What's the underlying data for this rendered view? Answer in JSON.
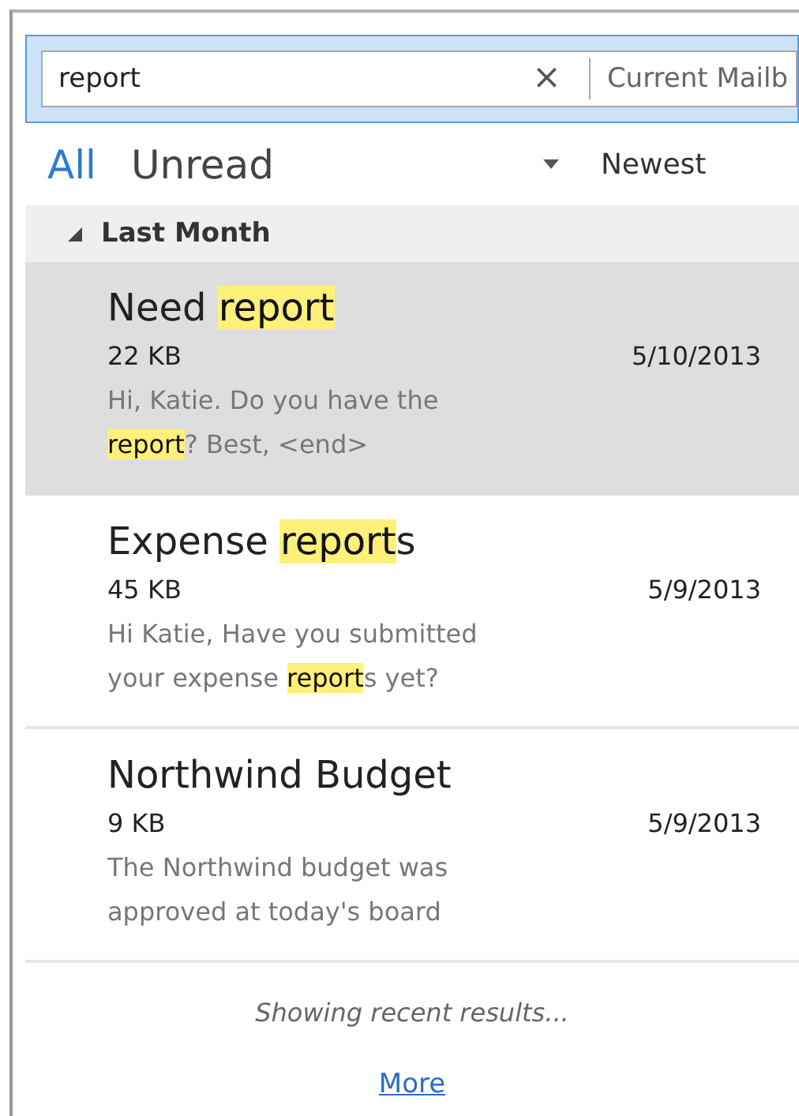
{
  "search": {
    "value": "report",
    "clear": "×",
    "scope": "Current Mailb"
  },
  "filters": [
    {
      "label": "All",
      "selected": true
    },
    {
      "label": "Unread",
      "selected": false
    }
  ],
  "sort": {
    "label": "Newest"
  },
  "group": {
    "title": "Last Month",
    "expanded": true
  },
  "messages": [
    {
      "selected": true,
      "subject": [
        {
          "text": "Need ",
          "highlight": false
        },
        {
          "text": "report",
          "highlight": true
        }
      ],
      "size": "22 KB",
      "date": "5/10/2013",
      "preview": [
        [
          {
            "text": "Hi, Katie. Do you have the",
            "highlight": false
          }
        ],
        [
          {
            "text": "report",
            "highlight": true
          },
          {
            "text": "?  Best, <end>",
            "highlight": false
          }
        ]
      ]
    },
    {
      "selected": false,
      "subject": [
        {
          "text": "Expense ",
          "highlight": false
        },
        {
          "text": "report",
          "highlight": true
        },
        {
          "text": "s",
          "highlight": false
        }
      ],
      "size": "45 KB",
      "date": "5/9/2013",
      "preview": [
        [
          {
            "text": "Hi Katie,  Have you submitted",
            "highlight": false
          }
        ],
        [
          {
            "text": "your expense ",
            "highlight": false
          },
          {
            "text": "report",
            "highlight": true
          },
          {
            "text": "s yet?",
            "highlight": false
          }
        ]
      ]
    },
    {
      "selected": false,
      "subject": [
        {
          "text": "Northwind Budget",
          "highlight": false
        }
      ],
      "size": "9 KB",
      "date": "5/9/2013",
      "preview": [
        [
          {
            "text": "The Northwind budget was",
            "highlight": false
          }
        ],
        [
          {
            "text": "approved at today's board",
            "highlight": false
          }
        ]
      ]
    }
  ],
  "footer": {
    "status": "Showing recent results...",
    "link": "More"
  }
}
